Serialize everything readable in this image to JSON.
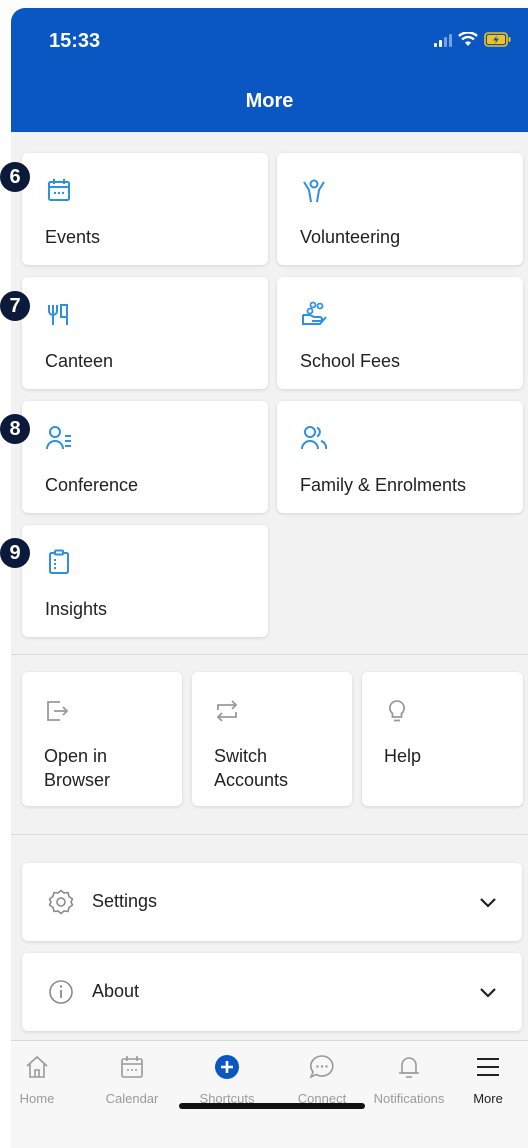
{
  "status_bar": {
    "time": "15:33"
  },
  "header": {
    "title": "More"
  },
  "badges": [
    "6",
    "7",
    "8",
    "9"
  ],
  "tiles": [
    {
      "label": "Events",
      "icon": "calendar-icon"
    },
    {
      "label": "Volunteering",
      "icon": "volunteer-icon"
    },
    {
      "label": "Canteen",
      "icon": "canteen-icon"
    },
    {
      "label": "School Fees",
      "icon": "hand-coins-icon"
    },
    {
      "label": "Conference",
      "icon": "conference-icon"
    },
    {
      "label": "Family & Enrolments",
      "icon": "family-icon"
    },
    {
      "label": "Insights",
      "icon": "clipboard-icon"
    }
  ],
  "utility_tiles": [
    {
      "label": "Open in Browser",
      "icon": "open-external-icon"
    },
    {
      "label": "Switch Accounts",
      "icon": "switch-icon"
    },
    {
      "label": "Help",
      "icon": "lightbulb-icon"
    }
  ],
  "rows": [
    {
      "label": "Settings",
      "icon": "gear-icon"
    },
    {
      "label": "About",
      "icon": "info-icon"
    }
  ],
  "tabbar": [
    {
      "label": "Home",
      "icon": "home-icon"
    },
    {
      "label": "Calendar",
      "icon": "calendar-icon"
    },
    {
      "label": "Shortcuts",
      "icon": "plus-circle-icon"
    },
    {
      "label": "Connect",
      "icon": "chat-icon"
    },
    {
      "label": "Notifications",
      "icon": "bell-icon"
    },
    {
      "label": "More",
      "icon": "menu-icon"
    }
  ],
  "colors": {
    "brand": "#0a56c2",
    "icon_blue": "#2f8fe0",
    "badge": "#0b1a3a"
  }
}
